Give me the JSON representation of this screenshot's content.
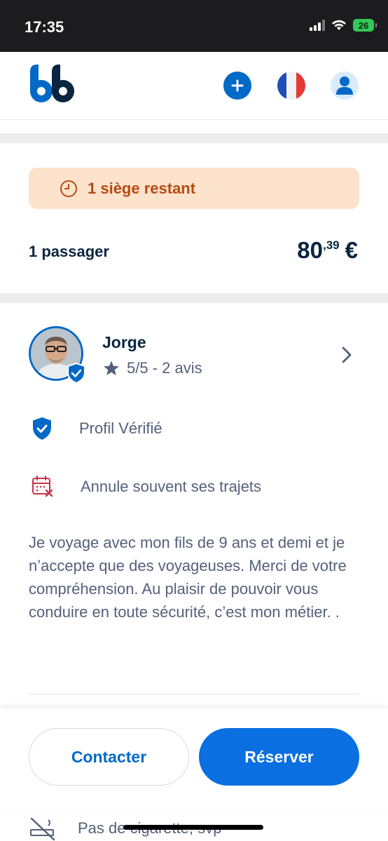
{
  "status_bar": {
    "time": "17:35",
    "battery": "26"
  },
  "header": {
    "logo_icon": "blablacar-logo-icon",
    "publish_icon": "plus-icon",
    "language_icon": "french-flag-icon",
    "profile_icon": "user-icon"
  },
  "colors": {
    "brand_blue": "#0069c7",
    "warning_bg": "#fde3cc",
    "warning_text": "#b84a12",
    "muted_text": "#54617a"
  },
  "trip": {
    "seats_remaining": "1 siège restant",
    "passenger_count": "1 passager",
    "price_integer": "80",
    "price_decimal": ",39",
    "price_currency": "€"
  },
  "driver": {
    "name": "Jorge",
    "rating": "5/5 - 2 avis",
    "verified_label": "Profil Vérifié",
    "cancels_label": "Annule souvent ses trajets",
    "bio": "Je voyage avec mon fils de 9 ans et demi et je n’accepte que des voyageuses. Merci de votre compréhension. Au plaisir de pouvoir vous conduire en toute sécurité, c’est mon métier. ."
  },
  "preferences": {
    "smoking": "Pas de cigarette, svp"
  },
  "actions": {
    "contact_label": "Contacter",
    "book_label": "Réserver"
  }
}
